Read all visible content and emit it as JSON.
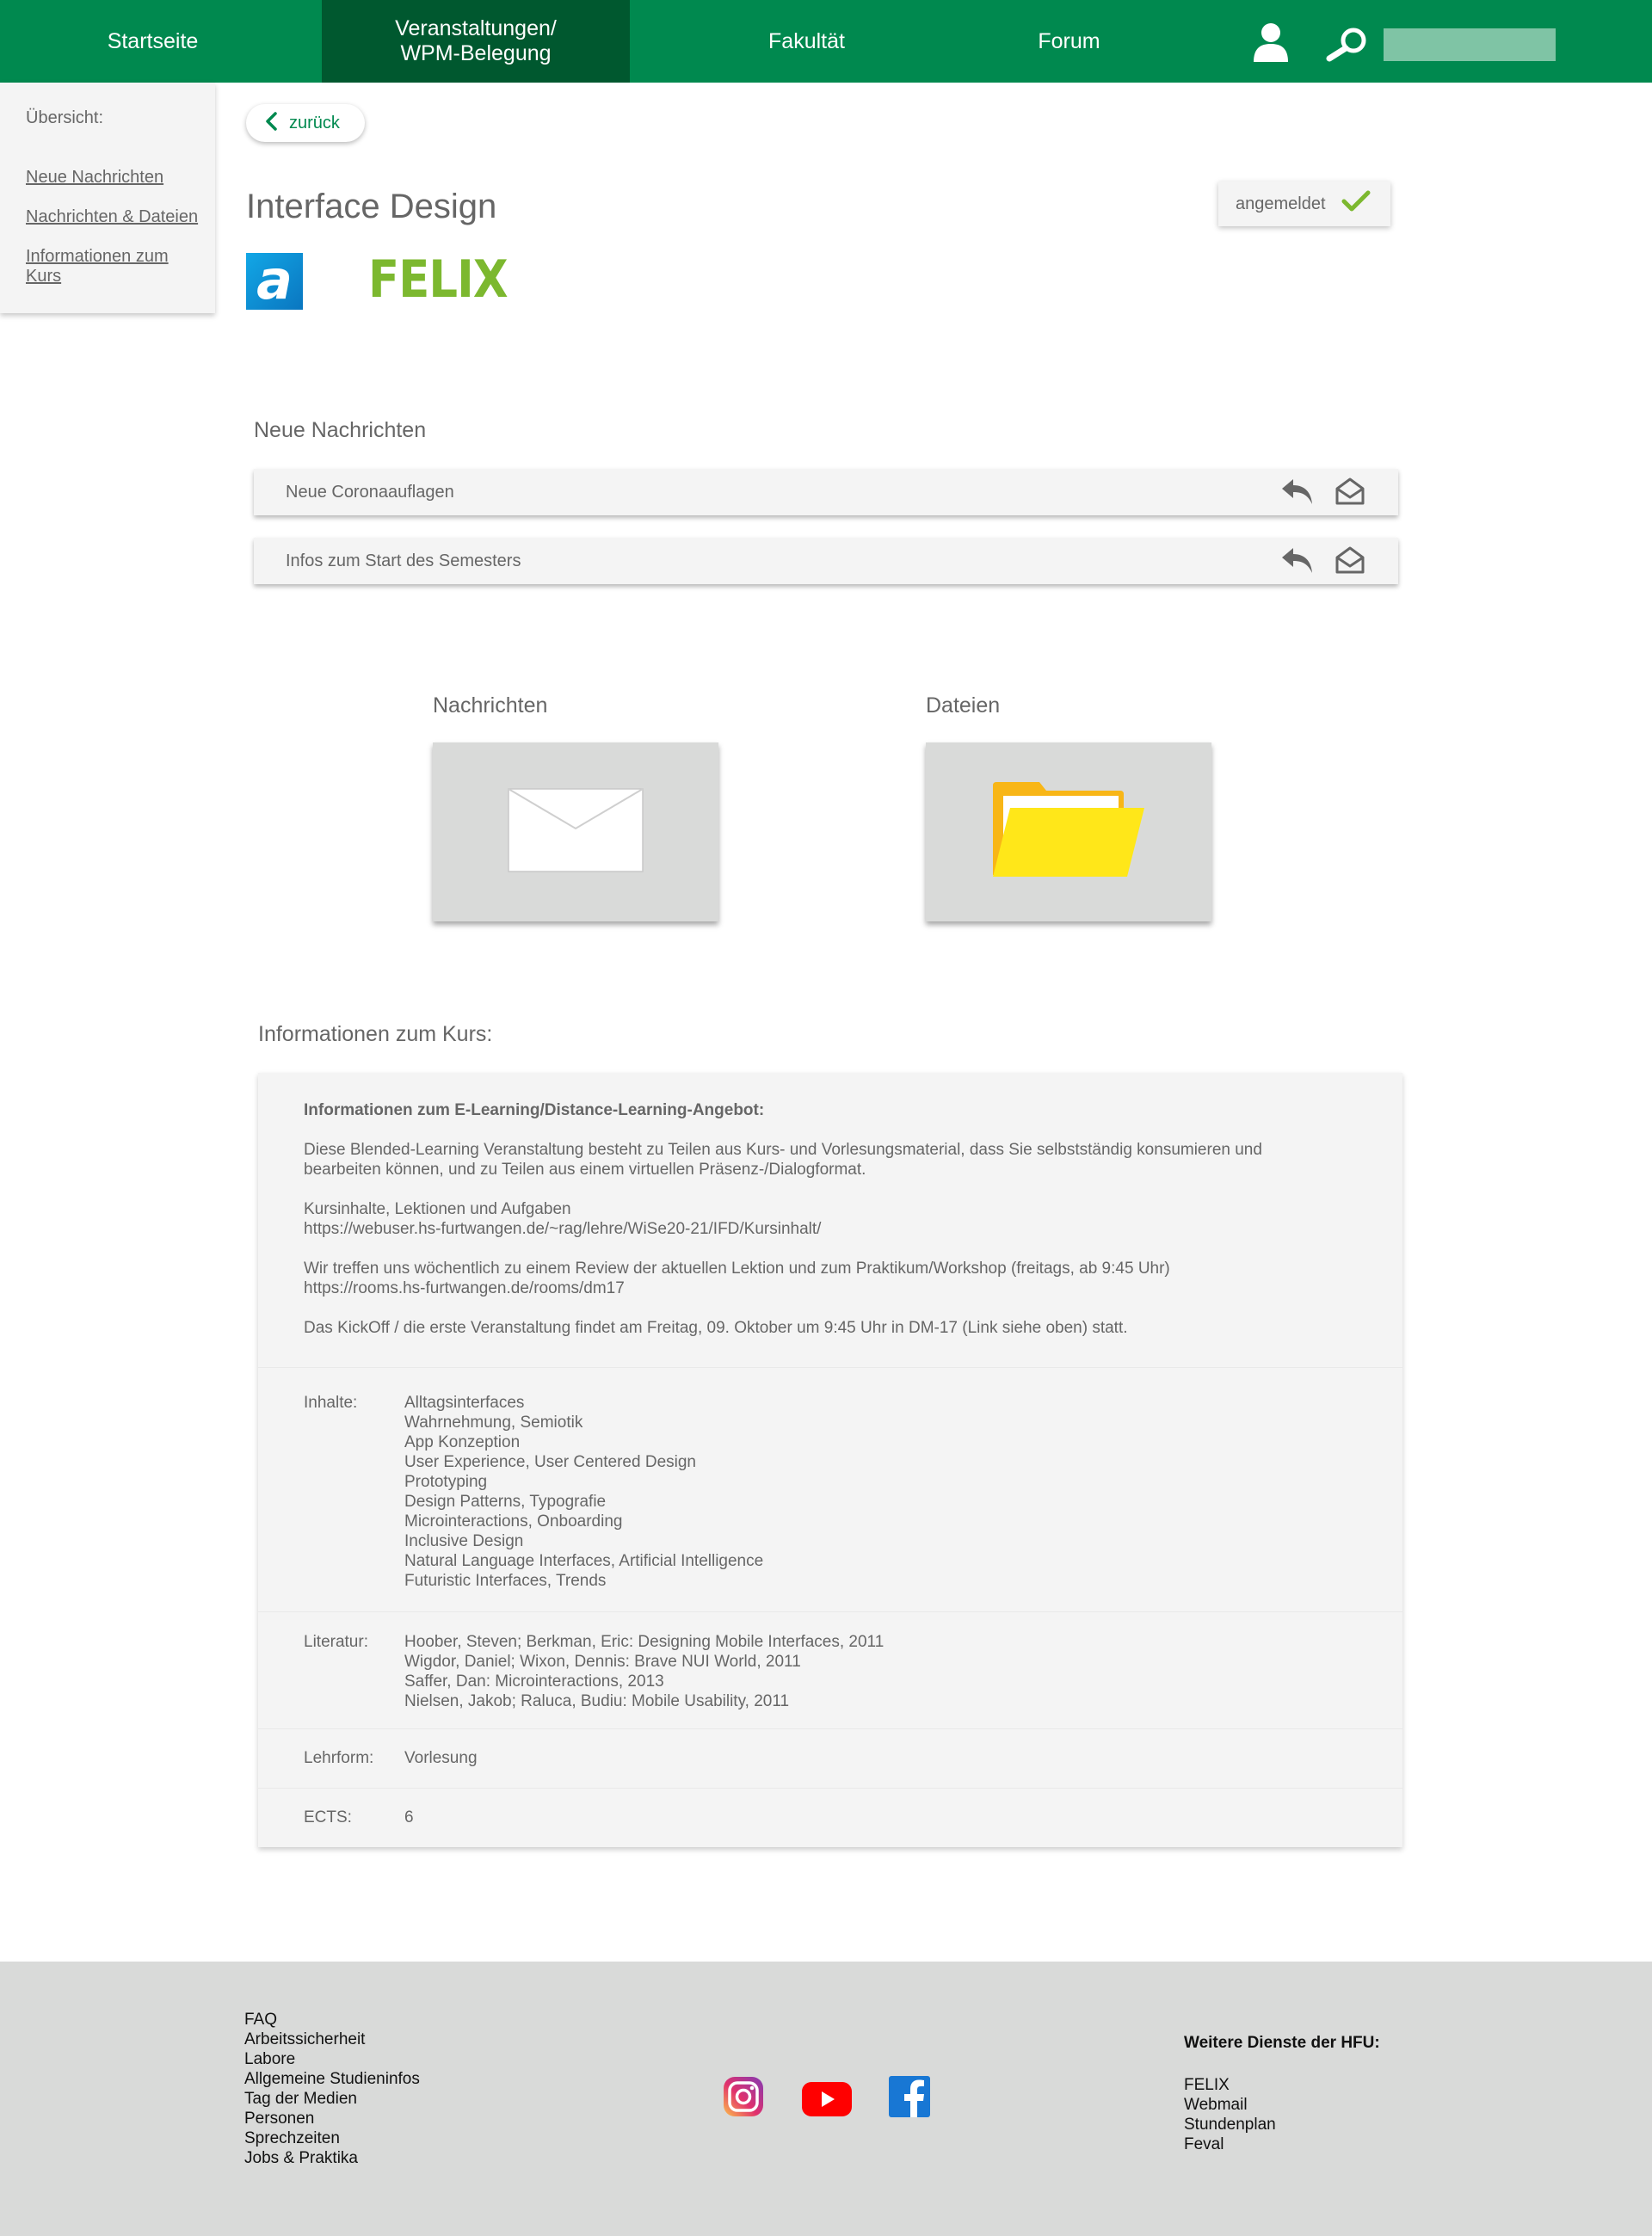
{
  "nav": {
    "items": [
      "Startseite",
      "Veranstaltungen/\nWPM-Belegung",
      "Fakultät",
      "Forum"
    ],
    "search_value": ""
  },
  "sidebar": {
    "title": "Übersicht:",
    "links": [
      "Neue Nachrichten",
      "Nachrichten & Dateien",
      "Informationen zum Kurs"
    ]
  },
  "header": {
    "back_label": "zurück",
    "course_title": "Interface Design",
    "status_label": "angemeldet",
    "logo_a": "a",
    "logo_felix": "FELIX"
  },
  "news": {
    "heading": "Neue Nachrichten",
    "items": [
      "Neue Coronaauflagen",
      "Infos zum Start des Semesters"
    ]
  },
  "tiles": {
    "messages_label": "Nachrichten",
    "files_label": "Dateien"
  },
  "course_info": {
    "heading": "Informationen zum Kurs:",
    "elearning_title": "Informationen zum E-Learning/Distance-Learning-Angebot:",
    "paragraphs": [
      "Diese Blended-Learning Veranstaltung besteht zu Teilen aus Kurs- und Vorlesungsmaterial, dass Sie selbstständig konsumieren und\nbearbeiten können, und zu Teilen aus einem virtuellen Präsenz-/Dialogformat.",
      "Kursinhalte, Lektionen und Aufgaben\nhttps://webuser.hs-furtwangen.de/~rag/lehre/WiSe20-21/IFD/Kursinhalt/",
      "Wir treffen uns wöchentlich zu einem Review der aktuellen Lektion und zum Praktikum/Workshop (freitags, ab 9:45 Uhr)\nhttps://rooms.hs-furtwangen.de/rooms/dm17",
      "Das KickOff / die erste Veranstaltung findet am Freitag, 09. Oktober um 9:45 Uhr in DM-17 (Link siehe oben) statt."
    ],
    "contents_label": "Inhalte:",
    "contents": "Alltagsinterfaces\nWahrnehmung, Semiotik\nApp Konzeption\nUser Experience, User Centered Design\nPrototyping\nDesign Patterns, Typografie\nMicrointeractions, Onboarding\nInclusive Design\nNatural Language Interfaces, Artificial Intelligence\nFuturistic Interfaces, Trends",
    "literature_label": "Literatur:",
    "literature": "Hoober, Steven; Berkman, Eric: Designing Mobile Interfaces, 2011\nWigdor, Daniel; Wixon, Dennis: Brave NUI World, 2011\nSaffer, Dan: Microinteractions, 2013\nNielsen, Jakob; Raluca, Budiu: Mobile Usability, 2011",
    "teaching_label": "Lehrform:",
    "teaching_value": "Vorlesung",
    "ects_label": "ECTS:",
    "ects_value": "6"
  },
  "footer": {
    "links": [
      "FAQ",
      "Arbeitssicherheit",
      "Labore",
      "Allgemeine Studieninfos",
      "Tag der Medien",
      "Personen",
      "Sprechzeiten",
      "Jobs & Praktika"
    ],
    "services_title": "Weitere Dienste der HFU:",
    "services": [
      "FELIX",
      "Webmail",
      "Stundenplan",
      "Feval"
    ],
    "social": [
      "instagram-icon",
      "youtube-icon",
      "facebook-icon"
    ]
  },
  "colors": {
    "brand_green": "#00894f",
    "active_green": "#00582f",
    "felix_green": "#7cb82f",
    "panel_gray": "#f4f4f4",
    "footer_gray": "#d9dad9"
  }
}
